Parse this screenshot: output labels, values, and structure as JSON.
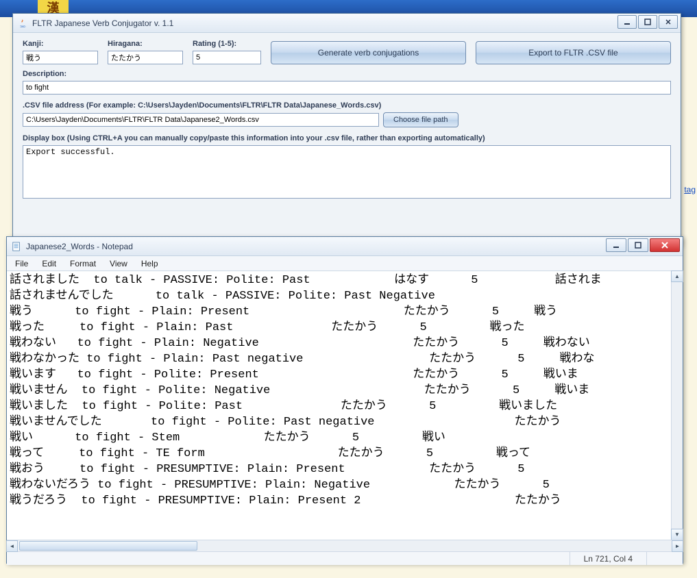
{
  "taskbar": {
    "icon_glyph": "漢"
  },
  "app": {
    "title": "FLTR Japanese Verb Conjugator v. 1.1",
    "labels": {
      "kanji": "Kanji:",
      "hiragana": "Hiragana:",
      "rating": "Rating (1-5):",
      "description": "Description:",
      "csv_label": ".CSV file address (For example: C:\\Users\\Jayden\\Documents\\FLTR\\FLTR Data\\Japanese_Words.csv)",
      "display_label": "Display box (Using CTRL+A you can manually copy/paste this information into your .csv file, rather than exporting automatically)"
    },
    "values": {
      "kanji": "戦う",
      "hiragana": "たたかう",
      "rating": "5",
      "description": "to fight",
      "csv_path": "C:\\Users\\Jayden\\Documents\\FLTR\\FLTR Data\\Japanese2_Words.csv",
      "display_box": "Export successful."
    },
    "buttons": {
      "generate": "Generate verb conjugations",
      "export": "Export to FLTR .CSV file",
      "choose": "Choose file path"
    }
  },
  "notepad": {
    "title": "Japanese2_Words - Notepad",
    "menu": {
      "file": "File",
      "edit": "Edit",
      "format": "Format",
      "view": "View",
      "help": "Help"
    },
    "status": "Ln 721, Col 4",
    "content": "話されました  to talk - PASSIVE: Polite: Past            はなす      5           話されま\n話されませんでした      to talk - PASSIVE: Polite: Past Negative\n戦う      to fight - Plain: Present                      たたかう      5     戦う\n戦った     to fight - Plain: Past              たたかう      5         戦った\n戦わない   to fight - Plain: Negative                      たたかう      5     戦わない\n戦わなかった to fight - Plain: Past negative                  たたかう      5     戦わな\n戦います   to fight - Polite: Present                      たたかう      5     戦いま\n戦いません  to fight - Polite: Negative                      たたかう      5     戦いま\n戦いました  to fight - Polite: Past              たたかう      5         戦いました\n戦いませんでした       to fight - Polite: Past negative                    たたかう\n戦い      to fight - Stem            たたかう      5         戦い\n戦って     to fight - TE form                   たたかう      5         戦って\n戦おう     to fight - PRESUMPTIVE: Plain: Present            たたかう      5\n戦わないだろう to fight - PRESUMPTIVE: Plain: Negative            たたかう      5\n戦うだろう  to fight - PRESUMPTIVE: Plain: Present 2                      たたかう"
  },
  "bg_link": "tag"
}
